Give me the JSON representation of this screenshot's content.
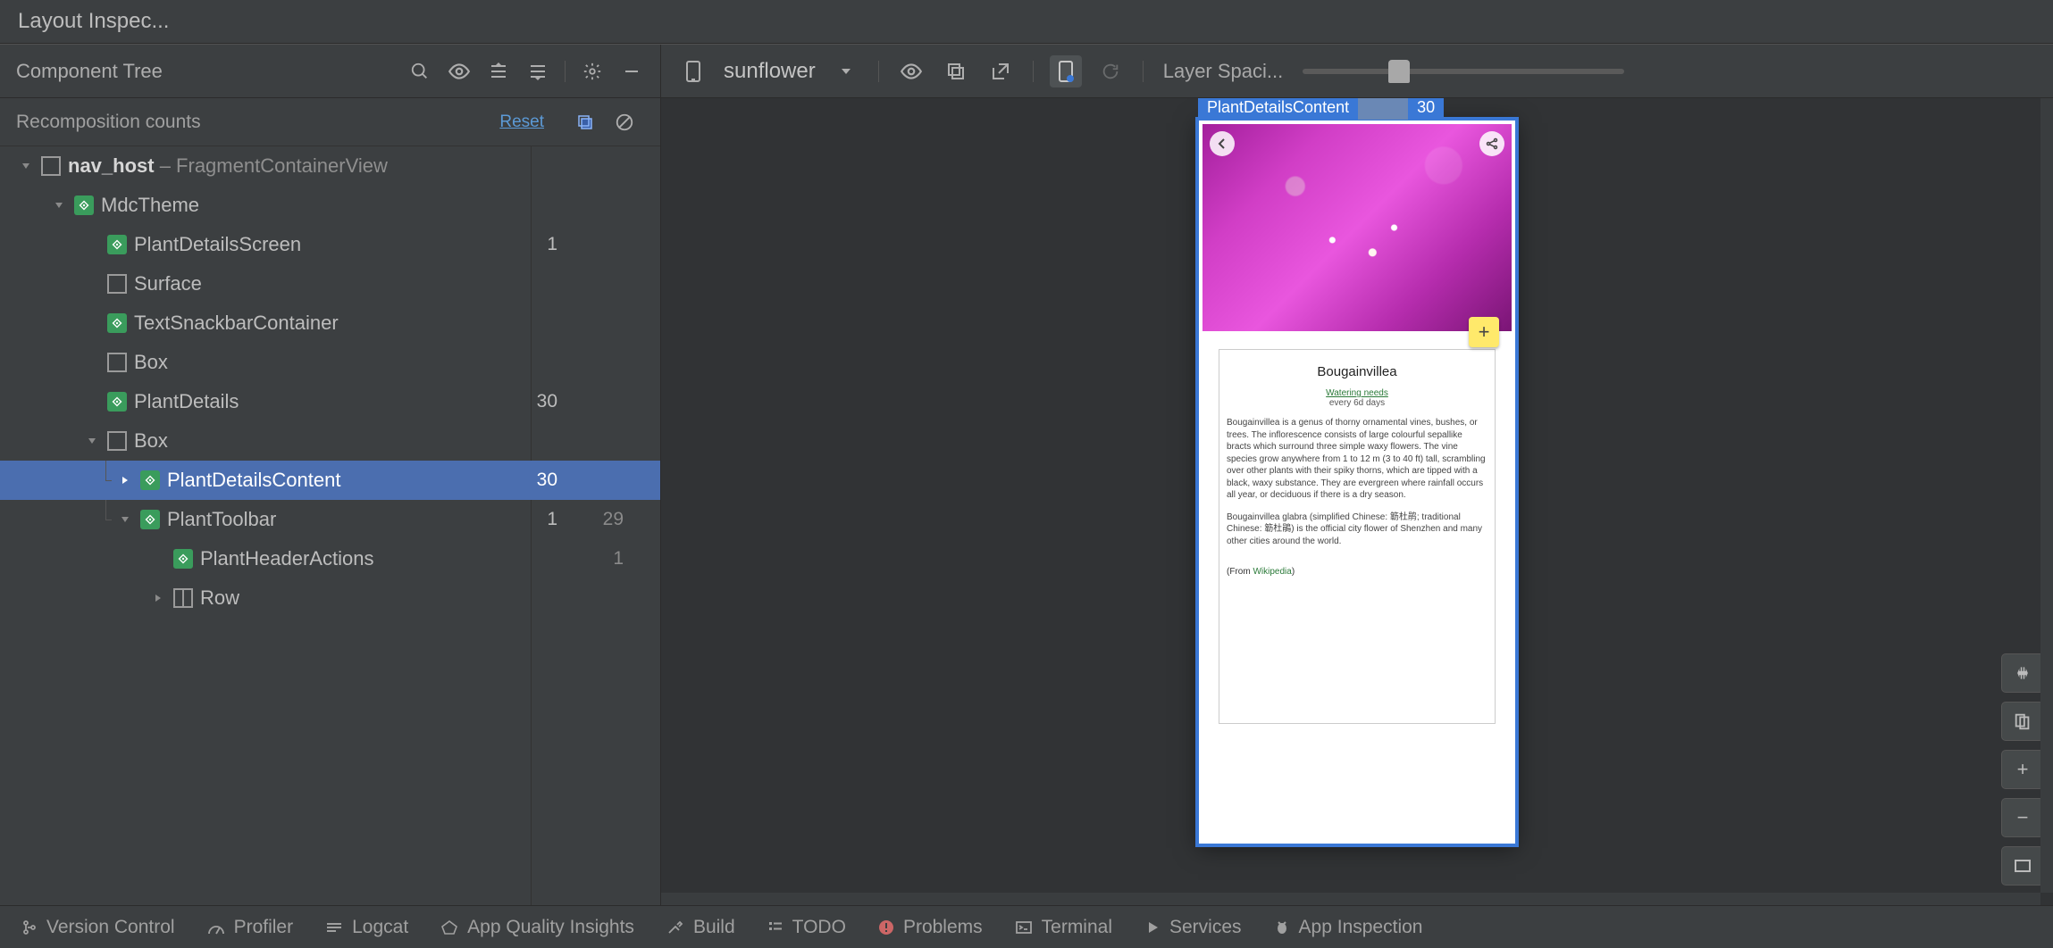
{
  "window": {
    "title": "Layout Inspec..."
  },
  "componentTree": {
    "title": "Component Tree",
    "recompHeader": "Recomposition counts",
    "resetLabel": "Reset"
  },
  "tree": [
    {
      "depth": 0,
      "chev": "down",
      "icon": "layout",
      "label_html": [
        "nav_host",
        " – FragmentContainerView"
      ],
      "c1": "",
      "c2": ""
    },
    {
      "depth": 1,
      "chev": "down",
      "icon": "compose",
      "label": "MdcTheme",
      "c1": "",
      "c2": ""
    },
    {
      "depth": 2,
      "chev": "",
      "icon": "compose",
      "label": "PlantDetailsScreen",
      "c1": "1",
      "c2": ""
    },
    {
      "depth": 2,
      "chev": "",
      "icon": "layout",
      "label": "Surface",
      "c1": "",
      "c2": ""
    },
    {
      "depth": 2,
      "chev": "",
      "icon": "compose",
      "label": "TextSnackbarContainer",
      "c1": "",
      "c2": ""
    },
    {
      "depth": 2,
      "chev": "",
      "icon": "layout",
      "label": "Box",
      "c1": "",
      "c2": ""
    },
    {
      "depth": 2,
      "chev": "",
      "icon": "compose",
      "label": "PlantDetails",
      "c1": "30",
      "c2": ""
    },
    {
      "depth": 2,
      "chev": "down",
      "icon": "layout",
      "label": "Box",
      "c1": "",
      "c2": ""
    },
    {
      "depth": 3,
      "chev": "right",
      "icon": "compose",
      "label": "PlantDetailsContent",
      "c1": "30",
      "c2": "",
      "selected": true,
      "guide": true
    },
    {
      "depth": 3,
      "chev": "down",
      "icon": "compose",
      "label": "PlantToolbar",
      "c1": "1",
      "c2": "29",
      "guide": true,
      "last_guide": true
    },
    {
      "depth": 4,
      "chev": "",
      "icon": "compose",
      "label": "PlantHeaderActions",
      "c1": "",
      "c2": "1"
    },
    {
      "depth": 4,
      "chev": "right",
      "icon": "rowcol",
      "label": "Row",
      "c1": "",
      "c2": ""
    }
  ],
  "preview": {
    "deviceLabel": "sunflower",
    "layerLabel": "Layer Spaci...",
    "sliderPercent": 30,
    "selection": {
      "name": "PlantDetailsContent",
      "count": "30"
    },
    "card": {
      "title": "Bougainvillea",
      "wateringNeedsLabel": "Watering needs",
      "wateringFreq": "every 6d days",
      "body1": "Bougainvillea is a genus of thorny ornamental vines, bushes, or trees. The inflorescence consists of large colourful sepallike bracts which surround three simple waxy flowers. The vine species grow anywhere from 1 to 12 m (3 to 40 ft) tall, scrambling over other plants with their spiky thorns, which are tipped with a black, waxy substance. They are evergreen where rainfall occurs all year, or deciduous if there is a dry season.",
      "body2": "Bougainvillea glabra (simplified Chinese: 簕杜鹃; traditional Chinese: 簕杜鵑) is the official city flower of Shenzhen and many other cities around the world.",
      "fromLabel": "(From ",
      "wikiLabel": "Wikipedia",
      "closeParen": ")"
    }
  },
  "statusBar": {
    "items": [
      "Version Control",
      "Profiler",
      "Logcat",
      "App Quality Insights",
      "Build",
      "TODO",
      "Problems",
      "Terminal",
      "Services",
      "App Inspection"
    ]
  }
}
